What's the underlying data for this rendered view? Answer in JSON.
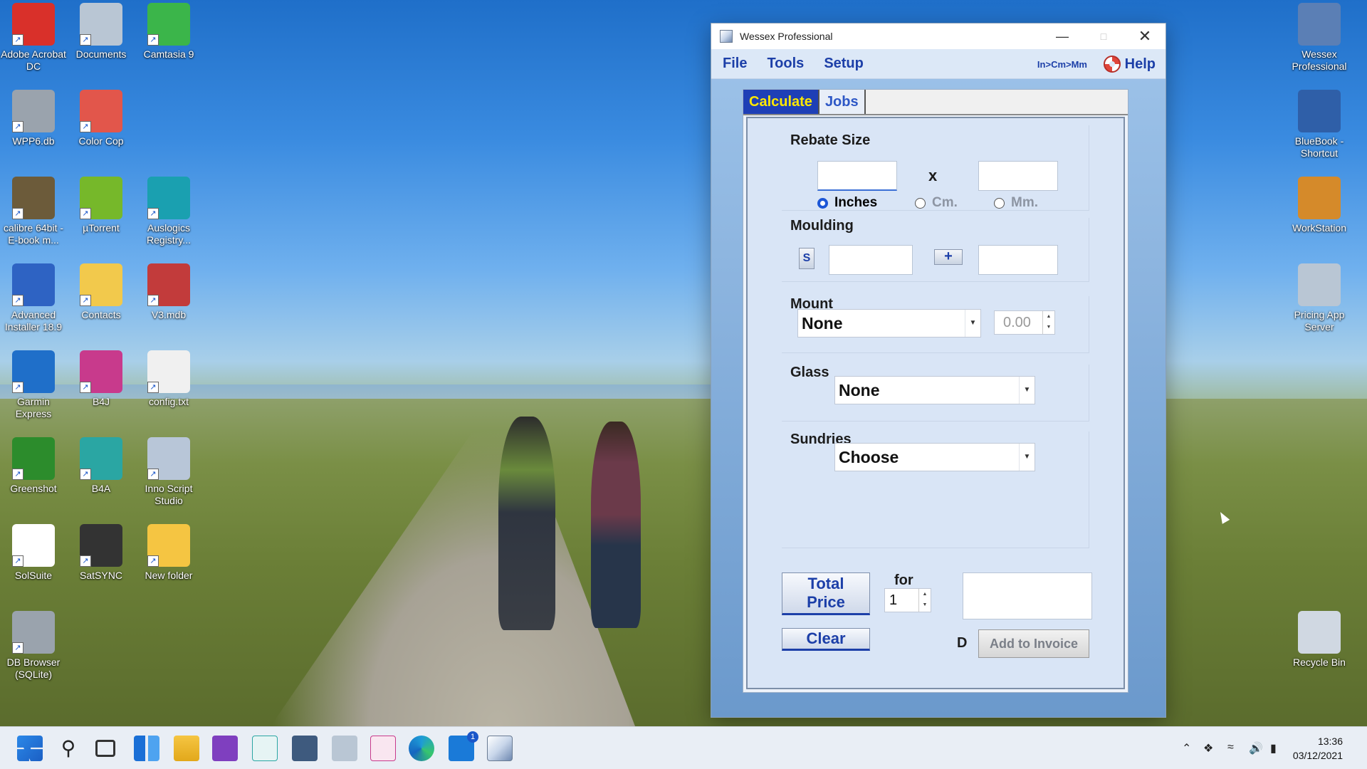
{
  "desktop": {
    "left_icons": [
      {
        "label": "Adobe Acrobat DC",
        "icon": "pdf-icon",
        "color": "#d9302a"
      },
      {
        "label": "Documents",
        "icon": "documents-icon",
        "color": "#b9c6d4"
      },
      {
        "label": "Camtasia 9",
        "icon": "camtasia-icon",
        "color": "#3bb54a"
      },
      {
        "label": "WPP6.db",
        "icon": "database-icon",
        "color": "#9aa3ad"
      },
      {
        "label": "Color Cop",
        "icon": "color-palette-icon",
        "color": "#e2564b"
      },
      {
        "label": "calibre 64bit - E-book m...",
        "icon": "books-icon",
        "color": "#6c5b3a"
      },
      {
        "label": "µTorrent",
        "icon": "utorrent-icon",
        "color": "#76b82a"
      },
      {
        "label": "Auslogics Registry...",
        "icon": "auslogics-icon",
        "color": "#1aa0b0"
      },
      {
        "label": "Advanced Installer 18.9",
        "icon": "installer-icon",
        "color": "#2e63c3"
      },
      {
        "label": "Contacts",
        "icon": "contacts-folder-icon",
        "color": "#f2c94c"
      },
      {
        "label": "V3.mdb",
        "icon": "access-db-icon",
        "color": "#c23b3b"
      },
      {
        "label": "Garmin Express",
        "icon": "garmin-icon",
        "color": "#1f6fc9"
      },
      {
        "label": "B4J",
        "icon": "b4j-icon",
        "color": "#c83a8c"
      },
      {
        "label": "config.txt",
        "icon": "text-file-icon",
        "color": "#f0f0f0"
      },
      {
        "label": "Greenshot",
        "icon": "greenshot-icon",
        "color": "#2c8c2c"
      },
      {
        "label": "B4A",
        "icon": "b4a-icon",
        "color": "#2aa6a3"
      },
      {
        "label": "Inno Script Studio",
        "icon": "inno-icon",
        "color": "#b8c6d8"
      },
      {
        "label": "SolSuite",
        "icon": "cards-icon",
        "color": "#ffffff"
      },
      {
        "label": "SatSYNC",
        "icon": "gps-device-icon",
        "color": "#333333"
      },
      {
        "label": "New folder",
        "icon": "folder-icon",
        "color": "#f5c542"
      },
      {
        "label": "DB Browser (SQLite)",
        "icon": "database-icon",
        "color": "#9aa3ad"
      }
    ],
    "right_icons": [
      {
        "label": "Wessex Professional",
        "icon": "wessex-icon",
        "color": "#5b7fb5"
      },
      {
        "label": "BlueBook - Shortcut",
        "icon": "address-book-icon",
        "color": "#2f5fa8"
      },
      {
        "label": "WorkStation",
        "icon": "workstation-icon",
        "color": "#d58a2a"
      },
      {
        "label": "Pricing App Server",
        "icon": "server-icon",
        "color": "#b9c6d4"
      },
      {
        "label": "Recycle Bin",
        "icon": "recycle-bin-icon",
        "color": "#d0d8e2"
      }
    ]
  },
  "window": {
    "title": "Wessex Professional",
    "menu": [
      "File",
      "Tools",
      "Setup"
    ],
    "units_link": "In>Cm>Mm",
    "help": "Help",
    "tabs": [
      {
        "label": "Calculate",
        "active": true
      },
      {
        "label": "Jobs",
        "active": false
      }
    ],
    "rebate": {
      "title": "Rebate Size",
      "separator": "x",
      "units": [
        {
          "label": "Inches",
          "checked": true
        },
        {
          "label": "Cm.",
          "checked": false
        },
        {
          "label": "Mm.",
          "checked": false
        }
      ]
    },
    "moulding": {
      "title": "Moulding",
      "s_button": "S",
      "plus_button": "+"
    },
    "mount": {
      "title": "Mount",
      "selected": "None",
      "value": "0.00"
    },
    "glass": {
      "title": "Glass",
      "selected": "None"
    },
    "sundries": {
      "title": "Sundries",
      "selected": "Choose"
    },
    "total_button": "Total Price",
    "for_label": "for",
    "quantity": "1",
    "clear_button": "Clear",
    "d_label": "D",
    "add_invoice_button": "Add to Invoice"
  },
  "taskbar": {
    "time": "13:36",
    "date": "03/12/2021",
    "badge": "1"
  }
}
